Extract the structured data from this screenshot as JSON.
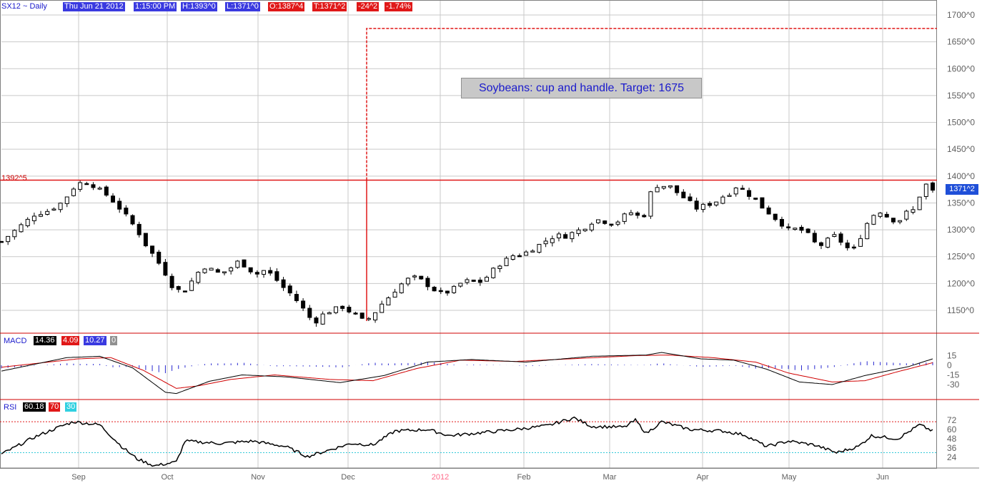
{
  "header": {
    "symbol": "SX12 ~ Daily",
    "date": "Thu Jun 21 2012",
    "time": "1:15:00 PM",
    "high": "H:1393^0",
    "low": "L:1371^0",
    "open": "O:1387^4",
    "trade": "T:1371^2",
    "change": "-24^2",
    "pct": "-1.74%"
  },
  "annotation": "Soybeans: cup and handle. Target: 1675",
  "resistance_label": "1392^5",
  "last_price_label": "1371^2",
  "macd": {
    "label": "MACD",
    "v1": "14.36",
    "v2": "4.09",
    "v3": "10.27",
    "v4": "0"
  },
  "rsi": {
    "label": "RSI",
    "v1": "60.18",
    "v2": "70",
    "v3": "30"
  },
  "colors": {
    "up": "#ffffff",
    "down": "#000000",
    "resistance": "#d00000",
    "signal": "#d00000",
    "macd": "#000000",
    "hist": "#2a2ad0"
  },
  "chart_data": {
    "type": "candlestick",
    "price_axis": {
      "min": 1110,
      "max": 1715,
      "ticks": [
        1150,
        1200,
        1250,
        1300,
        1350,
        1400,
        1450,
        1500,
        1550,
        1600,
        1650,
        1700
      ],
      "tick_labels": [
        "1150^0",
        "1200^0",
        "1250^0",
        "1300^0",
        "1350^0",
        "1400^0",
        "1450^0",
        "1500^0",
        "1550^0",
        "1600^0",
        "1650^0",
        "1700^0"
      ]
    },
    "months": [
      "Sep",
      "Oct",
      "Nov",
      "Dec",
      "2012",
      "Feb",
      "Mar",
      "Apr",
      "May",
      "Jun"
    ],
    "resistance": 1392.5,
    "target": 1675,
    "price_anchors": [
      [
        0,
        1278
      ],
      [
        8,
        1305
      ],
      [
        15,
        1328
      ],
      [
        22,
        1336
      ],
      [
        28,
        1352
      ],
      [
        33,
        1378
      ],
      [
        37,
        1390
      ],
      [
        41,
        1385
      ],
      [
        45,
        1374
      ],
      [
        49,
        1362
      ],
      [
        53,
        1345
      ],
      [
        57,
        1326
      ],
      [
        62,
        1300
      ],
      [
        66,
        1272
      ],
      [
        70,
        1250
      ],
      [
        74,
        1226
      ],
      [
        78,
        1196
      ],
      [
        83,
        1182
      ],
      [
        88,
        1210
      ],
      [
        92,
        1232
      ],
      [
        96,
        1226
      ],
      [
        100,
        1218
      ],
      [
        104,
        1226
      ],
      [
        108,
        1240
      ],
      [
        112,
        1232
      ],
      [
        116,
        1216
      ],
      [
        120,
        1224
      ],
      [
        124,
        1216
      ],
      [
        128,
        1196
      ],
      [
        132,
        1182
      ],
      [
        136,
        1164
      ],
      [
        140,
        1142
      ],
      [
        143,
        1126
      ],
      [
        147,
        1142
      ],
      [
        152,
        1152
      ],
      [
        156,
        1156
      ],
      [
        160,
        1146
      ],
      [
        163,
        1140
      ],
      [
        166,
        1128
      ],
      [
        170,
        1142
      ],
      [
        174,
        1162
      ],
      [
        178,
        1178
      ],
      [
        182,
        1196
      ],
      [
        186,
        1208
      ],
      [
        190,
        1212
      ],
      [
        194,
        1200
      ],
      [
        198,
        1188
      ],
      [
        202,
        1180
      ],
      [
        206,
        1188
      ],
      [
        210,
        1200
      ],
      [
        214,
        1206
      ],
      [
        218,
        1200
      ],
      [
        222,
        1212
      ],
      [
        226,
        1230
      ],
      [
        230,
        1242
      ],
      [
        234,
        1252
      ],
      [
        238,
        1254
      ],
      [
        242,
        1262
      ],
      [
        246,
        1272
      ],
      [
        250,
        1282
      ],
      [
        254,
        1290
      ],
      [
        258,
        1288
      ],
      [
        262,
        1296
      ],
      [
        266,
        1302
      ],
      [
        270,
        1314
      ],
      [
        274,
        1320
      ],
      [
        278,
        1310
      ],
      [
        282,
        1316
      ],
      [
        286,
        1330
      ],
      [
        290,
        1334
      ],
      [
        293,
        1310
      ],
      [
        296,
        1362
      ],
      [
        299,
        1382
      ],
      [
        302,
        1382
      ],
      [
        306,
        1380
      ],
      [
        310,
        1366
      ],
      [
        314,
        1354
      ],
      [
        318,
        1340
      ],
      [
        322,
        1346
      ],
      [
        326,
        1350
      ],
      [
        330,
        1362
      ],
      [
        334,
        1370
      ],
      [
        337,
        1385
      ],
      [
        340,
        1370
      ],
      [
        344,
        1360
      ],
      [
        348,
        1342
      ],
      [
        352,
        1328
      ],
      [
        356,
        1314
      ],
      [
        360,
        1300
      ],
      [
        364,
        1302
      ],
      [
        368,
        1296
      ],
      [
        372,
        1276
      ],
      [
        376,
        1270
      ],
      [
        380,
        1292
      ],
      [
        384,
        1278
      ],
      [
        388,
        1262
      ],
      [
        391,
        1266
      ],
      [
        394,
        1298
      ],
      [
        398,
        1326
      ],
      [
        402,
        1334
      ],
      [
        406,
        1322
      ],
      [
        410,
        1314
      ],
      [
        414,
        1332
      ],
      [
        418,
        1338
      ],
      [
        422,
        1388
      ],
      [
        426,
        1372
      ]
    ],
    "macd_axis": {
      "min": -45,
      "max": 25,
      "ticks": [
        15,
        0,
        -15,
        -30
      ],
      "tick_labels": [
        "15",
        "0",
        "-15",
        "-30"
      ]
    },
    "macd_anchors": [
      [
        0,
        -9
      ],
      [
        30,
        12
      ],
      [
        45,
        14
      ],
      [
        60,
        -4
      ],
      [
        75,
        -42
      ],
      [
        80,
        -44
      ],
      [
        95,
        -25
      ],
      [
        110,
        -15
      ],
      [
        130,
        -18
      ],
      [
        155,
        -27
      ],
      [
        175,
        -16
      ],
      [
        195,
        5
      ],
      [
        215,
        9
      ],
      [
        240,
        5
      ],
      [
        270,
        14
      ],
      [
        295,
        16
      ],
      [
        302,
        20
      ],
      [
        320,
        10
      ],
      [
        335,
        8
      ],
      [
        350,
        -6
      ],
      [
        365,
        -26
      ],
      [
        380,
        -30
      ],
      [
        395,
        -16
      ],
      [
        415,
        -2
      ],
      [
        426,
        10
      ]
    ],
    "signal_anchors": [
      [
        0,
        -3
      ],
      [
        35,
        10
      ],
      [
        50,
        12
      ],
      [
        65,
        -8
      ],
      [
        80,
        -36
      ],
      [
        90,
        -32
      ],
      [
        105,
        -22
      ],
      [
        125,
        -15
      ],
      [
        150,
        -22
      ],
      [
        170,
        -24
      ],
      [
        190,
        -5
      ],
      [
        210,
        8
      ],
      [
        235,
        6
      ],
      [
        260,
        10
      ],
      [
        290,
        15
      ],
      [
        305,
        16
      ],
      [
        325,
        12
      ],
      [
        345,
        5
      ],
      [
        360,
        -12
      ],
      [
        380,
        -26
      ],
      [
        395,
        -24
      ],
      [
        410,
        -10
      ],
      [
        426,
        4
      ]
    ],
    "rsi_axis": {
      "min": 8,
      "max": 86,
      "ticks": [
        72,
        60,
        48,
        36,
        24
      ],
      "tick_labels": [
        "72",
        "60",
        "48",
        "36",
        "24"
      ],
      "overbought": 70,
      "oversold": 30
    },
    "rsi_anchors": [
      [
        0,
        28
      ],
      [
        15,
        50
      ],
      [
        28,
        65
      ],
      [
        33,
        70
      ],
      [
        45,
        66
      ],
      [
        55,
        38
      ],
      [
        62,
        22
      ],
      [
        70,
        13
      ],
      [
        80,
        18
      ],
      [
        84,
        45
      ],
      [
        100,
        42
      ],
      [
        115,
        45
      ],
      [
        130,
        38
      ],
      [
        140,
        25
      ],
      [
        160,
        42
      ],
      [
        170,
        40
      ],
      [
        180,
        58
      ],
      [
        195,
        60
      ],
      [
        205,
        52
      ],
      [
        220,
        56
      ],
      [
        235,
        60
      ],
      [
        250,
        65
      ],
      [
        258,
        72
      ],
      [
        262,
        75
      ],
      [
        270,
        64
      ],
      [
        285,
        63
      ],
      [
        290,
        72
      ],
      [
        295,
        55
      ],
      [
        302,
        70
      ],
      [
        315,
        60
      ],
      [
        330,
        58
      ],
      [
        340,
        53
      ],
      [
        350,
        38
      ],
      [
        360,
        45
      ],
      [
        372,
        40
      ],
      [
        382,
        30
      ],
      [
        392,
        38
      ],
      [
        398,
        52
      ],
      [
        410,
        48
      ],
      [
        420,
        66
      ],
      [
        426,
        58
      ]
    ]
  }
}
